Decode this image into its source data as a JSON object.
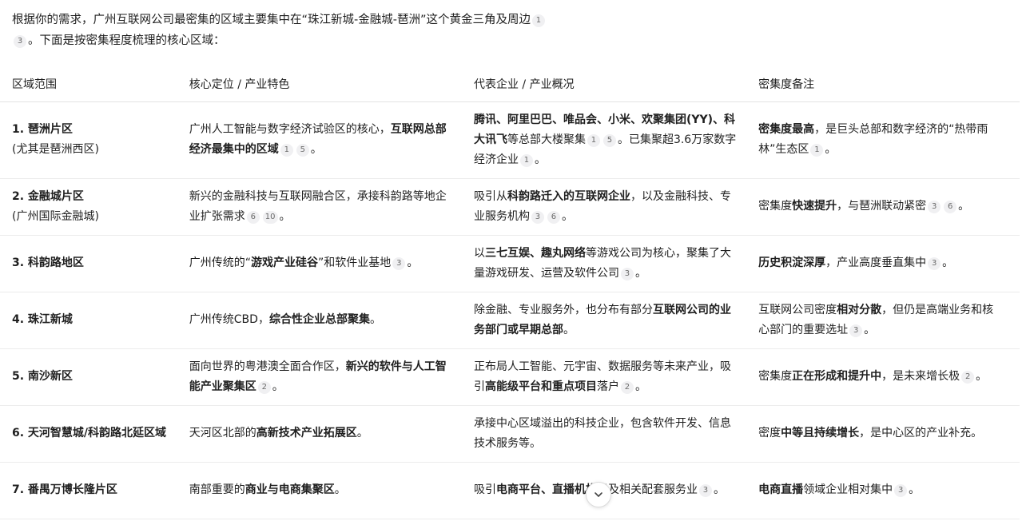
{
  "intro": {
    "line1": "根据你的需求，广州互联网公司最密集的区域主要集中在“珠江新城-金融城-琶洲”这个黄金三角及周边",
    "cite_a": "1",
    "cite_b": "3",
    "line2": "。下面是按密集程度梳理的核心区域："
  },
  "table": {
    "headers": [
      "区域范围",
      "核心定位 / 产业特色",
      "代表企业 / 产业概况",
      "密集度备注"
    ],
    "rows": [
      {
        "c1_title": "1. 琶洲片区",
        "c1_sub": "(尤其是琶洲西区)",
        "c2": [
          {
            "t": "广州人工智能与数字经济试验区的核心，",
            "b": false
          },
          {
            "t": "互联网总部经济最集中的区域",
            "b": true
          },
          {
            "c": "1"
          },
          {
            "c": "5"
          },
          {
            "t": "。",
            "b": false
          }
        ],
        "c3": [
          {
            "t": "腾讯、阿里巴巴、唯品会、小米、欢聚集团(YY)、科大讯飞",
            "b": true
          },
          {
            "t": "等总部大楼聚集",
            "b": false
          },
          {
            "c": "1"
          },
          {
            "c": "5"
          },
          {
            "t": "。已集聚超3.6万家数字经济企业",
            "b": false
          },
          {
            "c": "1"
          },
          {
            "t": "。",
            "b": false
          }
        ],
        "c4": [
          {
            "t": "密集度最高",
            "b": true
          },
          {
            "t": "，是巨头总部和数字经济的“热带雨林”生态区",
            "b": false
          },
          {
            "c": "1"
          },
          {
            "t": "。",
            "b": false
          }
        ]
      },
      {
        "c1_title": "2. 金融城片区",
        "c1_sub": "(广州国际金融城)",
        "c2": [
          {
            "t": "新兴的金融科技与互联网融合区，承接科韵路等地企业扩张需求",
            "b": false
          },
          {
            "c": "6"
          },
          {
            "c": "10"
          },
          {
            "t": "。",
            "b": false
          }
        ],
        "c3": [
          {
            "t": "吸引从",
            "b": false
          },
          {
            "t": "科韵路迁入的互联网企业",
            "b": true
          },
          {
            "t": "，以及金融科技、专业服务机构",
            "b": false
          },
          {
            "c": "3"
          },
          {
            "c": "6"
          },
          {
            "t": "。",
            "b": false
          }
        ],
        "c4": [
          {
            "t": "密集度",
            "b": false
          },
          {
            "t": "快速提升",
            "b": true
          },
          {
            "t": "，与琶洲联动紧密",
            "b": false
          },
          {
            "c": "3"
          },
          {
            "c": "6"
          },
          {
            "t": "。",
            "b": false
          }
        ]
      },
      {
        "c1_title": "3. 科韵路地区",
        "c1_sub": "",
        "c2": [
          {
            "t": "广州传统的“",
            "b": false
          },
          {
            "t": "游戏产业硅谷",
            "b": true
          },
          {
            "t": "”和软件业基地",
            "b": false
          },
          {
            "c": "3"
          },
          {
            "t": "。",
            "b": false
          }
        ],
        "c3": [
          {
            "t": "以",
            "b": false
          },
          {
            "t": "三七互娱、趣丸网络",
            "b": true
          },
          {
            "t": "等游戏公司为核心，聚集了大量游戏研发、运营及软件公司",
            "b": false
          },
          {
            "c": "3"
          },
          {
            "t": "。",
            "b": false
          }
        ],
        "c4": [
          {
            "t": "历史积淀深厚",
            "b": true
          },
          {
            "t": "，产业高度垂直集中",
            "b": false
          },
          {
            "c": "3"
          },
          {
            "t": "。",
            "b": false
          }
        ]
      },
      {
        "c1_title": "4. 珠江新城",
        "c1_sub": "",
        "c2": [
          {
            "t": "广州传统CBD，",
            "b": false
          },
          {
            "t": "综合性企业总部聚集",
            "b": true
          },
          {
            "t": "。",
            "b": false
          }
        ],
        "c3": [
          {
            "t": "除金融、专业服务外，也分布有部分",
            "b": false
          },
          {
            "t": "互联网公司的业务部门或早期总部",
            "b": true
          },
          {
            "t": "。",
            "b": false
          }
        ],
        "c4": [
          {
            "t": "互联网公司密度",
            "b": false
          },
          {
            "t": "相对分散",
            "b": true
          },
          {
            "t": "，但仍是高端业务和核心部门的重要选址",
            "b": false
          },
          {
            "c": "3"
          },
          {
            "t": "。",
            "b": false
          }
        ]
      },
      {
        "c1_title": "5. 南沙新区",
        "c1_sub": "",
        "c2": [
          {
            "t": "面向世界的粤港澳全面合作区，",
            "b": false
          },
          {
            "t": "新兴的软件与人工智能产业聚集区",
            "b": true
          },
          {
            "c": "2"
          },
          {
            "t": "。",
            "b": false
          }
        ],
        "c3": [
          {
            "t": "正布局人工智能、元宇宙、数据服务等未来产业，吸引",
            "b": false
          },
          {
            "t": "高能级平台和重点项目",
            "b": true
          },
          {
            "t": "落户",
            "b": false
          },
          {
            "c": "2"
          },
          {
            "t": "。",
            "b": false
          }
        ],
        "c4": [
          {
            "t": "密集度",
            "b": false
          },
          {
            "t": "正在形成和提升中",
            "b": true
          },
          {
            "t": "，是未来增长极",
            "b": false
          },
          {
            "c": "2"
          },
          {
            "t": "。",
            "b": false
          }
        ]
      },
      {
        "c1_title": "6. 天河智慧城/科韵路北延区域",
        "c1_sub": "",
        "c2": [
          {
            "t": "天河区北部的",
            "b": false
          },
          {
            "t": "高新技术产业拓展区",
            "b": true
          },
          {
            "t": "。",
            "b": false
          }
        ],
        "c3": [
          {
            "t": "承接中心区域溢出的科技企业，包含软件开发、信息技术服务等。",
            "b": false
          }
        ],
        "c4": [
          {
            "t": "密度",
            "b": false
          },
          {
            "t": "中等且持续增长",
            "b": true
          },
          {
            "t": "，是中心区的产业补充。",
            "b": false
          }
        ]
      },
      {
        "c1_title": "7. 番禺万博长隆片区",
        "c1_sub": "",
        "c2": [
          {
            "t": "南部重要的",
            "b": false
          },
          {
            "t": "商业与电商集聚区",
            "b": true
          },
          {
            "t": "。",
            "b": false
          }
        ],
        "c3": [
          {
            "t": "吸引",
            "b": false
          },
          {
            "t": "电商平台、直播机构",
            "b": true
          },
          {
            "t": "以及相关配套服务业",
            "b": false
          },
          {
            "c": "3"
          },
          {
            "t": "。",
            "b": false
          }
        ],
        "c4": [
          {
            "t": "电商直播",
            "b": true
          },
          {
            "t": "领域企业相对集中",
            "b": false
          },
          {
            "c": "3"
          },
          {
            "t": "。",
            "b": false
          }
        ]
      }
    ]
  },
  "scroll_button": {
    "icon": "chevron-down-icon"
  }
}
